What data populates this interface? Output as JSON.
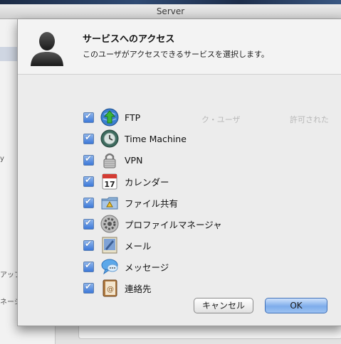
{
  "window": {
    "title": "Server"
  },
  "background": {
    "sidebar_fragments": [
      "y",
      "アップデート",
      "ネージャ"
    ],
    "main_fragments": [
      "ク・ユーザ",
      "許可された"
    ]
  },
  "sheet": {
    "title": "サービスへのアクセス",
    "description": "このユーザがアクセスできるサービスを選択します。",
    "services": [
      {
        "label": "FTP",
        "icon": "ftp-icon",
        "checked": true
      },
      {
        "label": "Time Machine",
        "icon": "time-machine-icon",
        "checked": true
      },
      {
        "label": "VPN",
        "icon": "vpn-icon",
        "checked": true
      },
      {
        "label": "カレンダー",
        "icon": "calendar-icon",
        "checked": true
      },
      {
        "label": "ファイル共有",
        "icon": "file-sharing-icon",
        "checked": true
      },
      {
        "label": "プロファイルマネージャ",
        "icon": "profile-manager-icon",
        "checked": true
      },
      {
        "label": "メール",
        "icon": "mail-icon",
        "checked": true
      },
      {
        "label": "メッセージ",
        "icon": "messages-icon",
        "checked": true
      },
      {
        "label": "連絡先",
        "icon": "contacts-icon",
        "checked": true
      }
    ],
    "calendar_day": "17",
    "cancel_label": "キャンセル",
    "ok_label": "OK"
  }
}
